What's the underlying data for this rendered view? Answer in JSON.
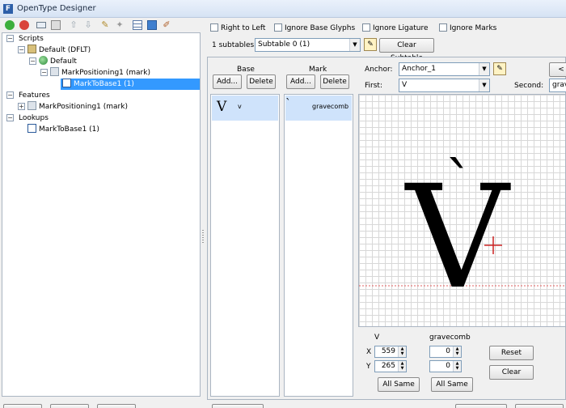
{
  "window": {
    "title": "OpenType Designer",
    "app_icon_letter": "F"
  },
  "toolbar_icons": [
    "add-icon",
    "remove-icon",
    "rename-icon",
    "copy-icon",
    "move-up-icon",
    "move-down-icon",
    "edit-icon",
    "wand-icon",
    "table-icon",
    "preview-icon",
    "brush-icon"
  ],
  "tree": {
    "scripts_label": "Scripts",
    "default_dflt_label": "Default (DFLT)",
    "default_label": "Default",
    "markpos_label": "MarkPositioning1 (mark)",
    "marktobase_label": "MarkToBase1 (1)",
    "features_label": "Features",
    "feature_markpos_label": "MarkPositioning1 (mark)",
    "lookups_label": "Lookups",
    "lookup_marktobase_label": "MarkToBase1 (1)"
  },
  "options": {
    "right_to_left": "Right to Left",
    "ignore_base_glyphs": "Ignore Base Glyphs",
    "ignore_ligature": "Ignore Ligature",
    "ignore_marks": "Ignore Marks"
  },
  "subtables": {
    "count_label": "1 subtables",
    "selected": "Subtable 0 (1)",
    "clear_label": "Clear Subtable"
  },
  "base_panel": {
    "header": "Base",
    "add_label": "Add...",
    "delete_label": "Delete",
    "items": [
      {
        "glyph": "V",
        "name": "v"
      }
    ]
  },
  "mark_panel": {
    "header": "Mark",
    "add_label": "Add...",
    "delete_label": "Delete",
    "items": [
      {
        "glyph": "`",
        "name": "gravecomb"
      }
    ]
  },
  "anchor": {
    "anchor_label": "Anchor:",
    "anchor_value": "Anchor_1",
    "first_label": "First:",
    "first_value": "V",
    "second_label": "Second:",
    "second_value": "grav",
    "nav_label": "<"
  },
  "preview": {
    "base_glyph": "V",
    "mark_glyph": "`"
  },
  "positions": {
    "base_header": "V",
    "mark_header": "gravecomb",
    "x_label": "X",
    "y_label": "Y",
    "base_x": "559",
    "base_y": "265",
    "mark_x": "0",
    "mark_y": "0",
    "all_same_label": "All Same",
    "reset_label": "Reset",
    "clear_label": "Clear"
  },
  "colors": {
    "selection": "#3399ff",
    "crosshair": "#cc2222",
    "baseline": "#e06060"
  }
}
